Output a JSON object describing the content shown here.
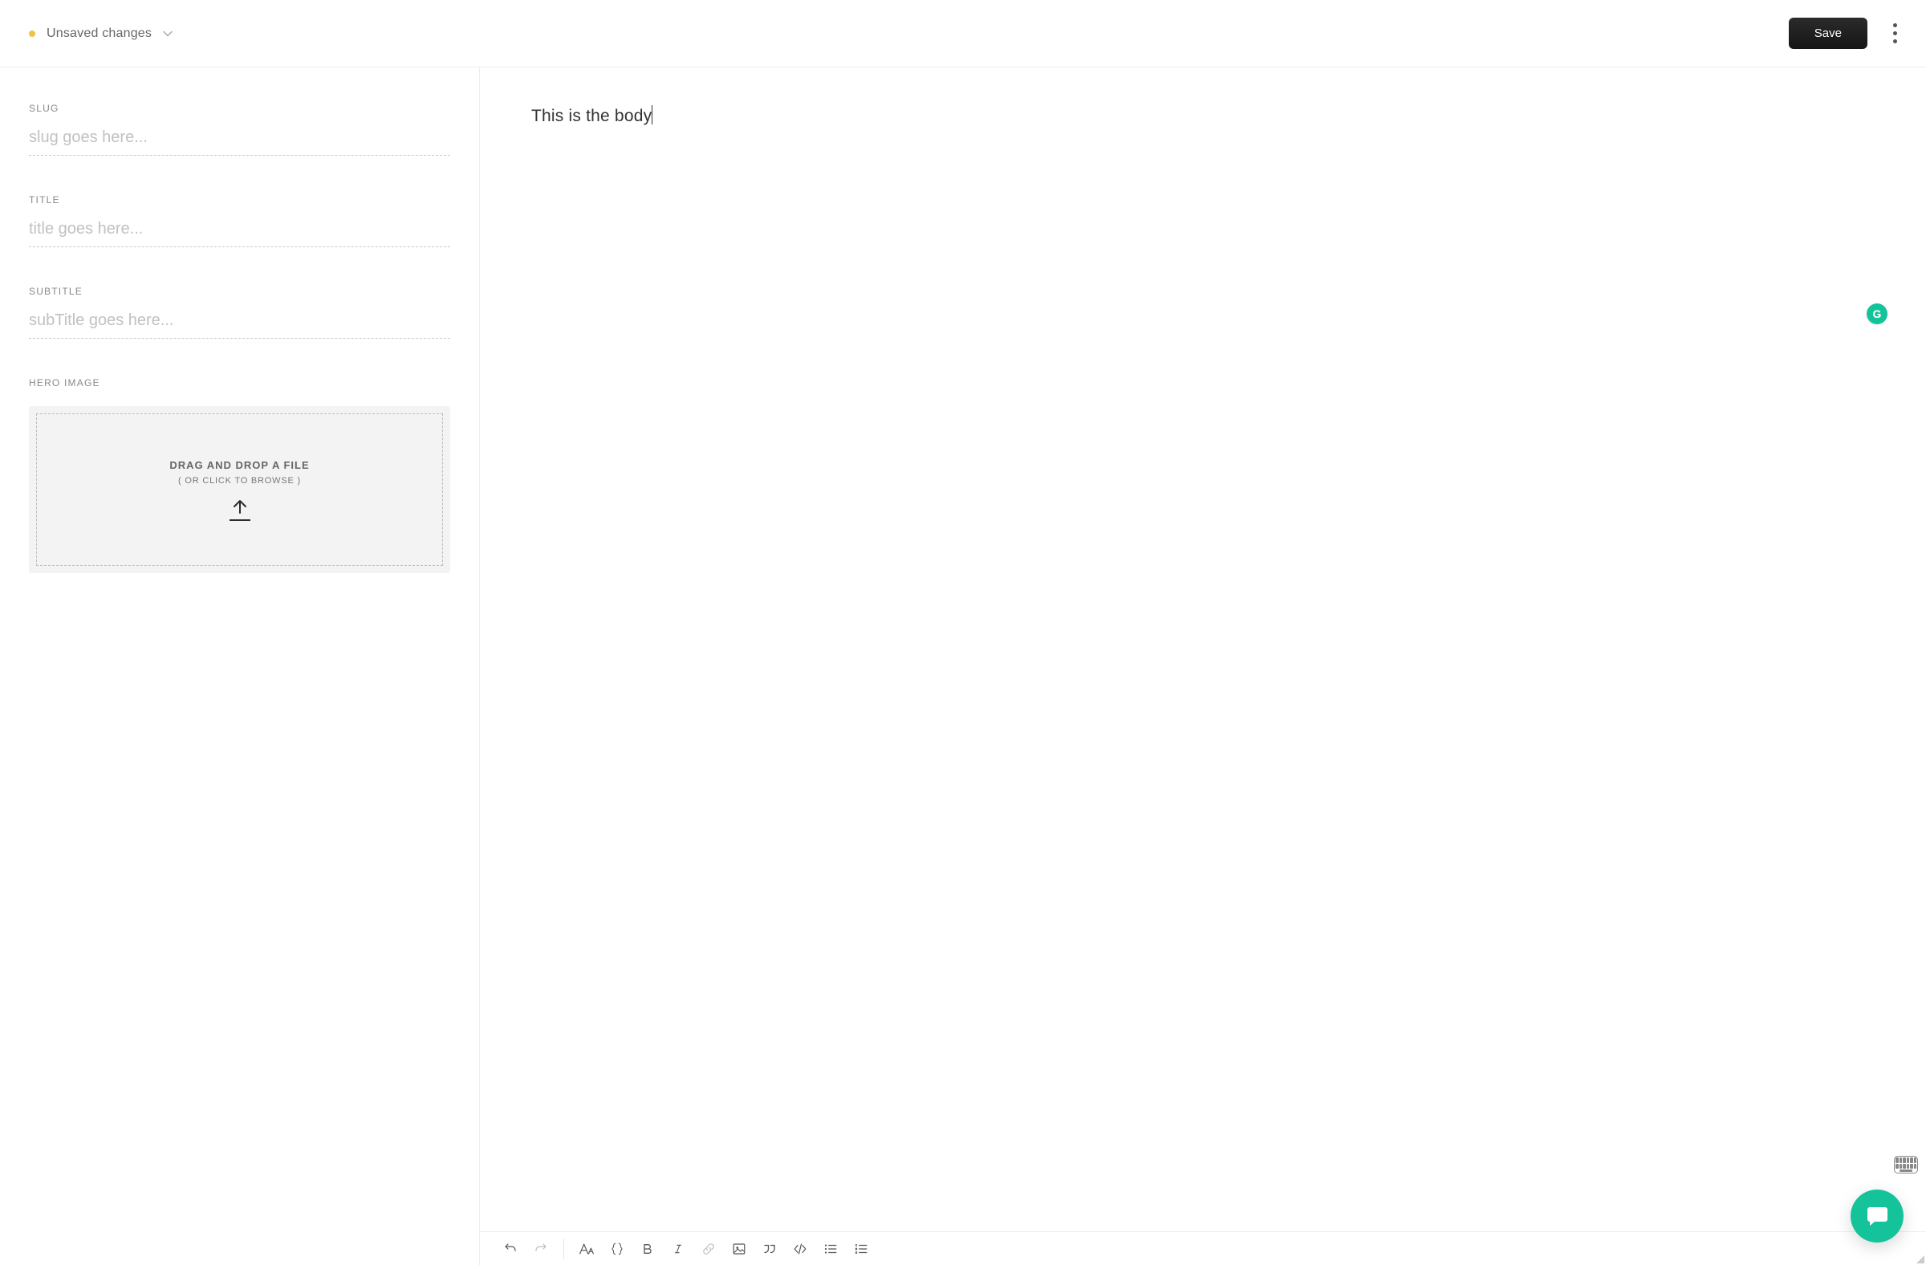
{
  "header": {
    "status_text": "Unsaved changes",
    "status_dot_color": "#f3c244",
    "save_label": "Save"
  },
  "fields": {
    "slug": {
      "label": "SLUG",
      "placeholder": "slug goes here...",
      "value": ""
    },
    "title": {
      "label": "TITLE",
      "placeholder": "title goes here...",
      "value": ""
    },
    "subtitle": {
      "label": "SUBTITLE",
      "placeholder": "subTitle goes here...",
      "value": ""
    },
    "hero": {
      "label": "HERO IMAGE",
      "drop_main": "DRAG AND DROP A FILE",
      "drop_sub": "( OR CLICK TO BROWSE )"
    }
  },
  "editor": {
    "body_text": "This is the body"
  },
  "toolbar": {
    "items": [
      "undo",
      "redo",
      "|",
      "font-size",
      "braces",
      "bold",
      "italic",
      "link",
      "image",
      "quote",
      "code",
      "ul",
      "ol"
    ]
  },
  "widgets": {
    "grammarly_glyph": "G"
  },
  "colors": {
    "accent": "#15c39a",
    "save_button_bg": "#1d1d1d"
  }
}
